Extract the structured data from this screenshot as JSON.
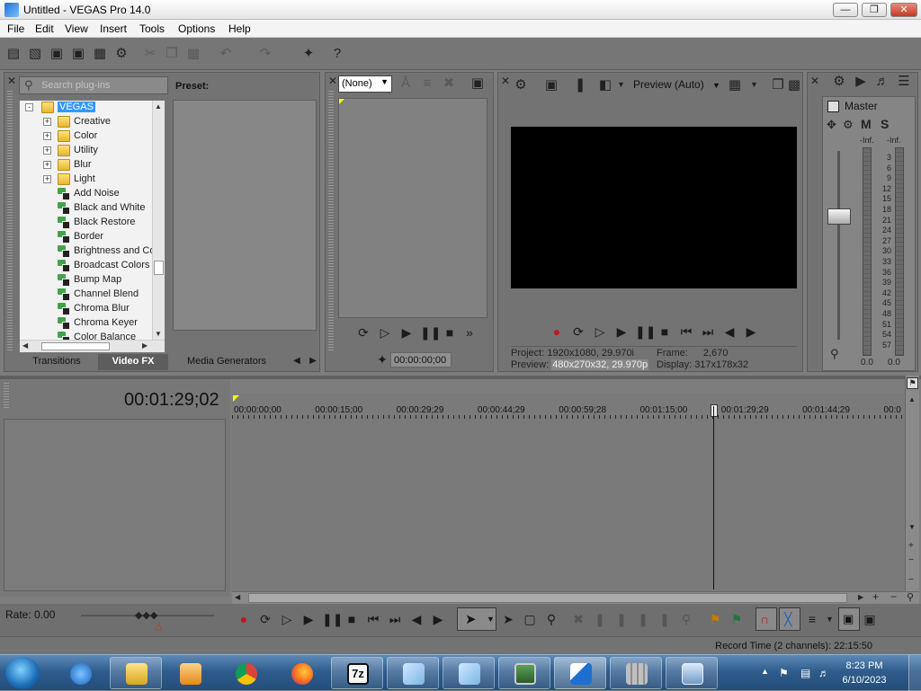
{
  "window": {
    "title": "Untitled - VEGAS Pro 14.0",
    "minimize": "—",
    "maximize": "❐",
    "close": "✕"
  },
  "menu": [
    "File",
    "Edit",
    "View",
    "Insert",
    "Tools",
    "Options",
    "Help"
  ],
  "plugins": {
    "search_placeholder": "Search plug-ins",
    "preset_label": "Preset:",
    "tree_root": "VEGAS",
    "folders": [
      "Creative",
      "Color",
      "Utility",
      "Blur",
      "Light"
    ],
    "effects": [
      "Add Noise",
      "Black and White",
      "Black Restore",
      "Border",
      "Brightness and Co",
      "Broadcast Colors",
      "Bump Map",
      "Channel Blend",
      "Chroma Blur",
      "Chroma Keyer",
      "Color Balance"
    ],
    "tabs": [
      "Transitions",
      "Video FX",
      "Media Generators"
    ],
    "active_tab": "Video FX"
  },
  "trimmer": {
    "selection": "(None)",
    "timecode": "00:00:00;00"
  },
  "preview": {
    "quality": "Preview (Auto)",
    "project_label": "Project:",
    "project_value": "1920x1080, 29.970i",
    "preview_label": "Preview:",
    "preview_value": "480x270x32, 29.970p",
    "frame_label": "Frame:",
    "frame_value": "2,670",
    "display_label": "Display:",
    "display_value": "317x178x32"
  },
  "mixer": {
    "master_label": "Master",
    "mute": "M",
    "solo": "S",
    "inf_left": "-Inf.",
    "inf_right": "-Inf.",
    "scale": [
      "3",
      "6",
      "9",
      "12",
      "15",
      "18",
      "21",
      "24",
      "27",
      "30",
      "33",
      "36",
      "39",
      "42",
      "45",
      "48",
      "51",
      "54",
      "57"
    ],
    "level_left": "0.0",
    "level_right": "0.0"
  },
  "timeline": {
    "cursor_time": "00:01:29;02",
    "ruler": [
      "00:00:00;00",
      "00:00:15;00",
      "00:00:29;29",
      "00:00:44;29",
      "00:00:59;28",
      "00:01:15;00",
      "00:01:29;29",
      "00:01:44;29",
      "00:0"
    ],
    "rate": "Rate: 0.00",
    "record_time": "Record Time (2 channels): 22:15:50"
  },
  "taskbar": {
    "time": "8:23 PM",
    "date": "6/10/2023"
  },
  "icons": {
    "new": "new-file-icon",
    "open": "open-folder-icon",
    "save": "save-icon",
    "properties": "gear-icon",
    "help": "help-icon"
  }
}
